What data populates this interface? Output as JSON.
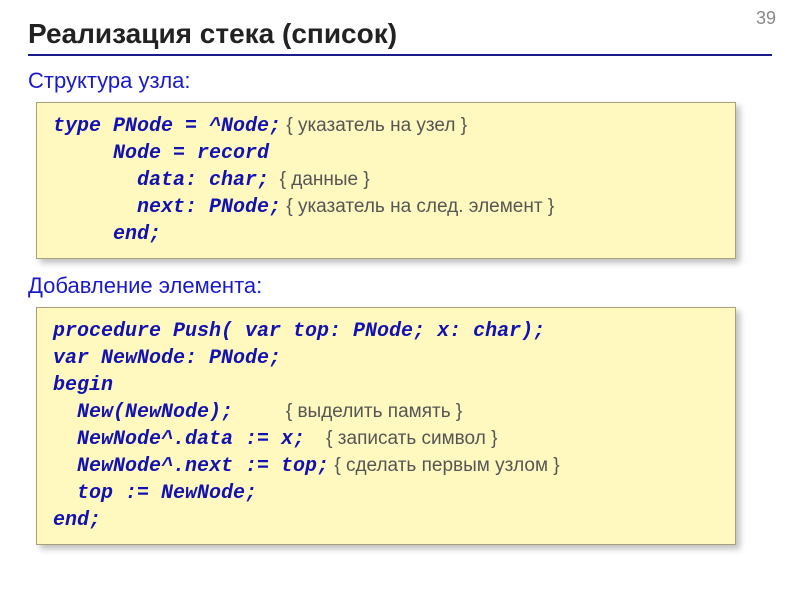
{
  "page_number": "39",
  "title": "Реализация стека (список)",
  "sub1": "Структура узла:",
  "sub2": "Добавление элемента:",
  "block1": {
    "l1a": "type PNode = ^Node;",
    "l1c": " { указатель на узел }",
    "l2": "     Node = record",
    "l3a": "       data: char;",
    "l3c": "  { данные }",
    "l4a": "       next: PNode;",
    "l4c": " { указатель на след. элемент }",
    "l5": "     end;"
  },
  "block2": {
    "l1": "procedure Push( var top: PNode; x: char);",
    "l2": "var NewNode: PNode;",
    "l3": "begin",
    "l4a": "  New(NewNode);",
    "l4c": "          { выделить память }",
    "l5a": "  NewNode^.data := x;",
    "l5c": "    { записать символ }",
    "l6a": "  NewNode^.next := top;",
    "l6c": " { сделать первым узлом }",
    "l7": "  top := NewNode;",
    "l8": "end;"
  }
}
